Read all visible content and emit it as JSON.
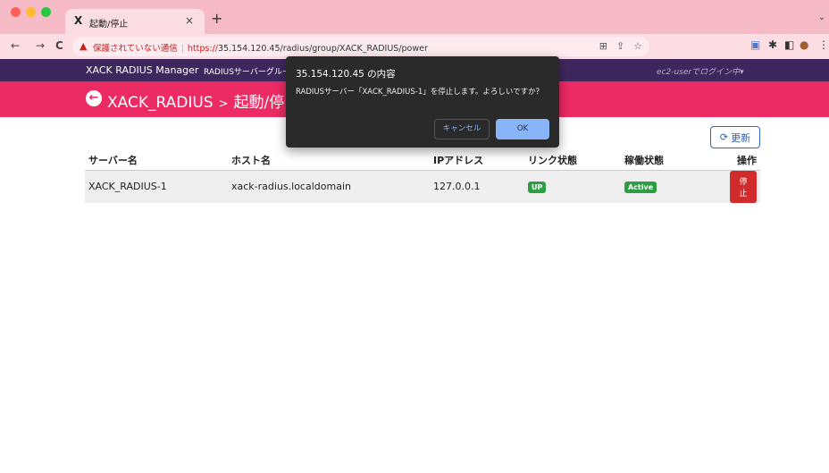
{
  "browser": {
    "tab_title": "起動/停止",
    "tab_favicon": "X",
    "tab_close": "×",
    "new_tab": "+",
    "tab_menu": "⌄",
    "back": "←",
    "forward": "→",
    "reload": "C",
    "security_label": "保護されていない通信",
    "url_scheme": "https://",
    "url_host": "35.154.120.45",
    "url_path": "/radius/group/XACK_RADIUS/power"
  },
  "navbar": {
    "brand": "XACK RADIUS Manager",
    "link": "RADIUSサーバーグルー",
    "login_status": "ec2-userでログイン中▾"
  },
  "header": {
    "group": "XACK_RADIUS",
    "separator": ">",
    "page": "起動/停"
  },
  "refresh_button": {
    "label": "更新",
    "icon": "⟳"
  },
  "table": {
    "headers": [
      "サーバー名",
      "ホスト名",
      "IPアドレス",
      "リンク状態",
      "稼働状態",
      "操作"
    ],
    "rows": [
      {
        "server_name": "XACK_RADIUS-1",
        "host_name": "xack-radius.localdomain",
        "ip": "127.0.0.1",
        "link_status": "UP",
        "run_status": "Active",
        "action": "停止"
      }
    ]
  },
  "dialog": {
    "title": "35.154.120.45 の内容",
    "message": "RADIUSサーバー「XACK_RADIUS-1」を停止します。よろしいですか？",
    "cancel_label": "キャンセル",
    "ok_label": "OK"
  },
  "colors": {
    "tabstrip": "#f6bac6",
    "navbar": "#3e275d",
    "header_band": "#ec2a63",
    "badge_green": "#2e9e44",
    "stop_red": "#d22b2b",
    "dialog_bg": "#2a2a2b",
    "ok_blue": "#8ab4f8"
  }
}
